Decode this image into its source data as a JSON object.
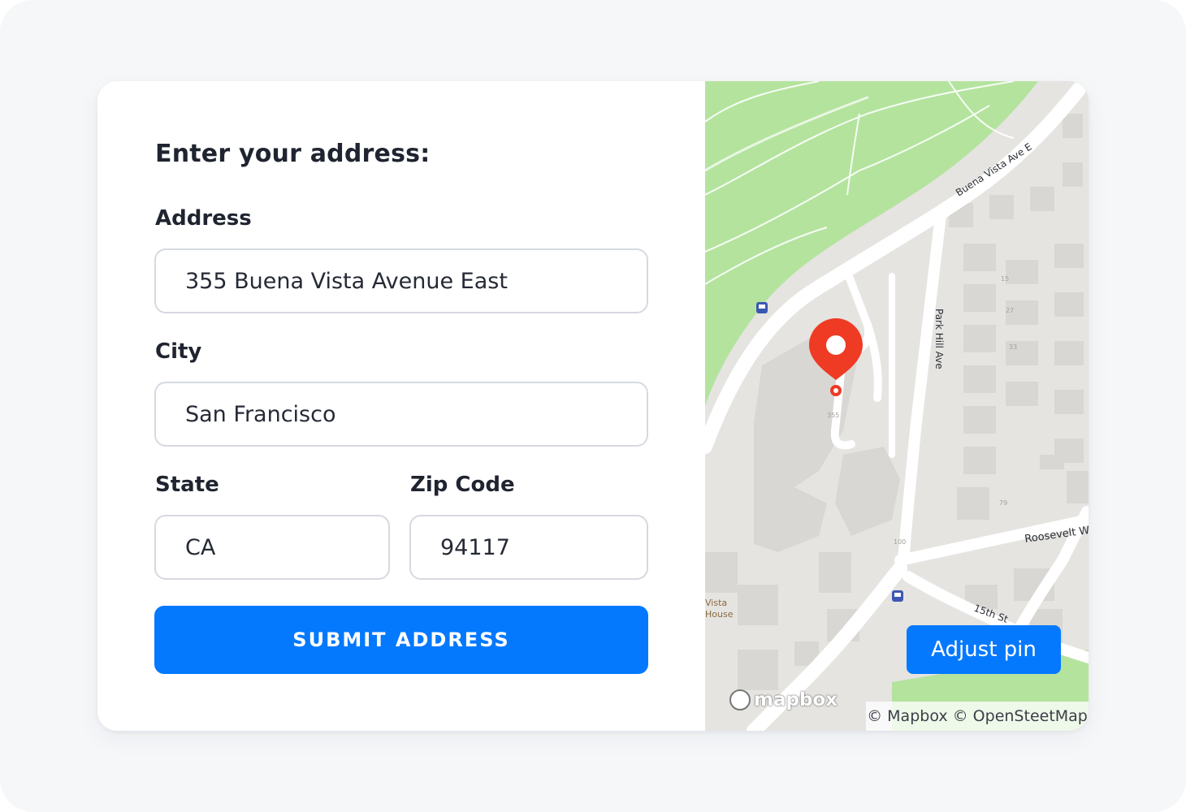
{
  "form": {
    "title": "Enter your address:",
    "address": {
      "label": "Address",
      "value": "355 Buena Vista Avenue East"
    },
    "city": {
      "label": "City",
      "value": "San Francisco"
    },
    "state": {
      "label": "State",
      "value": "CA"
    },
    "zip": {
      "label": "Zip Code",
      "value": "94117"
    },
    "submit_label": "SUBMIT ADDRESS"
  },
  "map": {
    "adjust_pin_label": "Adjust pin",
    "attribution": "© Mapbox © OpenSteetMap",
    "logo_text": "mapbox",
    "streets": {
      "buena_vista": "Buena Vista Ave E",
      "park_hill": "Park Hill Ave",
      "roosevelt": "Roosevelt W",
      "fifteenth": "15th St"
    },
    "poi": [
      "Vista",
      "House"
    ],
    "building_numbers": [
      "355",
      "100",
      "79",
      "15",
      "27",
      "33"
    ],
    "pin_color": "#ef3a24"
  },
  "colors": {
    "accent": "#0479fe",
    "park": "#b4e39e",
    "road": "#ffffff"
  }
}
